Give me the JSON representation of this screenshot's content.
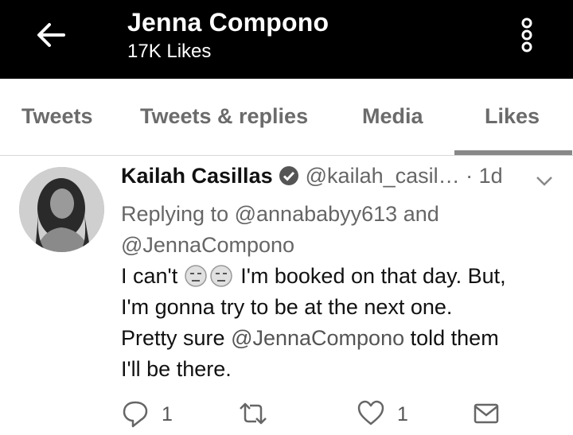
{
  "header": {
    "title": "Jenna Compono",
    "subtitle": "17K Likes"
  },
  "tabs": [
    "Tweets",
    "Tweets & replies",
    "Media",
    "Likes"
  ],
  "active_tab": "Likes",
  "tweet": {
    "name": "Kailah Casillas",
    "handle": "@kailah_casil…",
    "time": "· 1d",
    "reply_prefix": "Replying to",
    "reply_user1": "@annababyy613",
    "reply_and": "and",
    "reply_user2": "@JennaCompono",
    "text_1": "I can't",
    "text_2": "I'm booked on that day. But,",
    "text_3": "I'm gonna try to be at the next one.",
    "text_4": "Pretty sure",
    "mention": "@JennaCompono",
    "text_5": "told them",
    "text_6": "I'll be there."
  },
  "actions": {
    "reply_count": "1",
    "like_count": "1"
  },
  "icons": [
    "back-arrow-icon",
    "more-options-icon",
    "verified-badge-icon",
    "chevron-down-icon",
    "reply-icon",
    "retweet-icon",
    "like-icon",
    "message-icon",
    "emoji-icon"
  ]
}
